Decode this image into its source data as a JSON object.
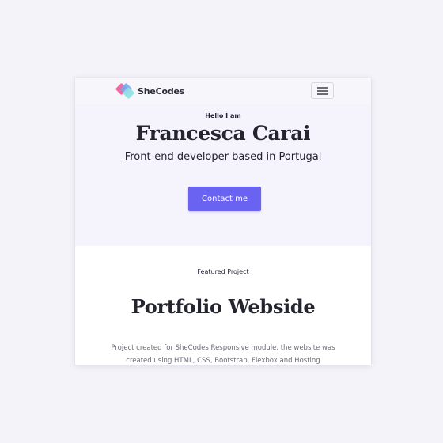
{
  "navbar": {
    "brand": "SheCodes",
    "menu_icon": "hamburger-menu-icon"
  },
  "hero": {
    "greeting": "Hello I am",
    "name": "Francesca Carai",
    "tagline": "Front-end developer based in Portugal",
    "contact_label": "Contact me"
  },
  "featured": {
    "label": "Featured Project",
    "title": "Portfolio Webside",
    "description": "Project created for SheCodes Responsive module, the website was created using HTML, CSS, Bootstrap, Flexbox and Hosting"
  },
  "colors": {
    "page_bg": "#f4f3f9",
    "hero_bg": "#f5f3fc",
    "accent": "#6a63f2",
    "text_dark": "#1f1f2e"
  }
}
